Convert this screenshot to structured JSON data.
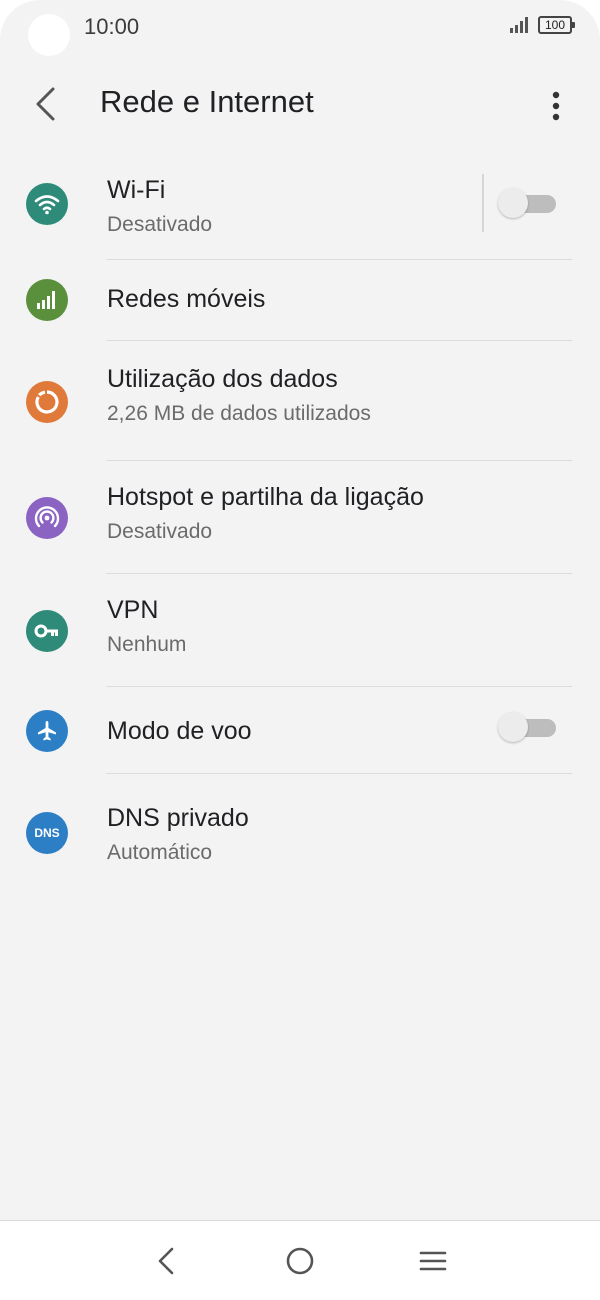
{
  "status_bar": {
    "time": "10:00",
    "battery": "100"
  },
  "app_bar": {
    "title": "Rede e Internet",
    "back_icon": "back-arrow-icon",
    "more_icon": "more-vert-icon"
  },
  "items": [
    {
      "title": "Wi-Fi",
      "subtitle": "Desativado",
      "icon": "wifi-icon",
      "icon_color": "#2e8b7a",
      "toggle": "off"
    },
    {
      "title": "Redes móveis",
      "icon": "signal-bars-icon",
      "icon_color": "#5a8f3c"
    },
    {
      "title": "Utilização dos dados",
      "subtitle": "2,26 MB de dados utilizados",
      "icon": "data-usage-icon",
      "icon_color": "#e07a3a"
    },
    {
      "title": "Hotspot e partilha da ligação",
      "subtitle": "Desativado",
      "icon": "hotspot-icon",
      "icon_color": "#8b63c3"
    },
    {
      "title": "VPN",
      "subtitle": "Nenhum",
      "icon": "key-icon",
      "icon_color": "#2e8b7a"
    },
    {
      "title": "Modo de voo",
      "icon": "airplane-icon",
      "icon_color": "#2d7fc5",
      "toggle": "off"
    },
    {
      "title": "DNS privado",
      "subtitle": "Automático",
      "icon": "dns-icon",
      "icon_color": "#2d7fc5",
      "icon_text": "DNS"
    }
  ],
  "nav_bar": {
    "back": "nav-back-icon",
    "home": "nav-home-icon",
    "menu": "nav-menu-icon"
  }
}
